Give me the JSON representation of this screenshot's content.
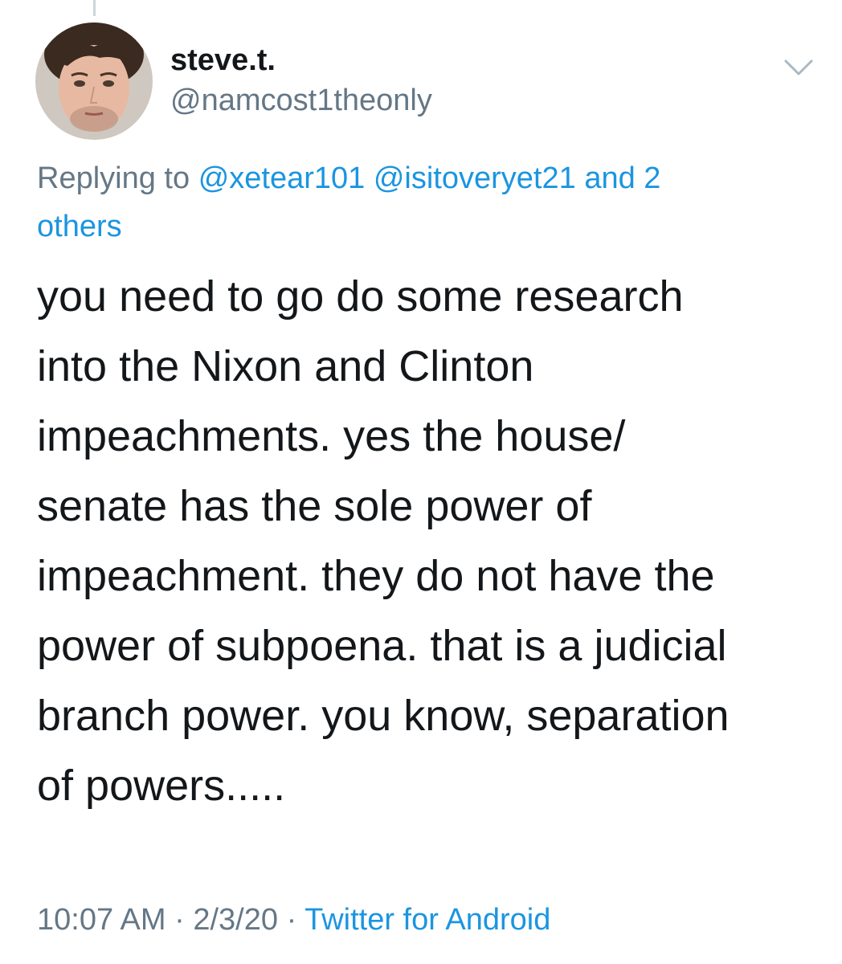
{
  "tweet": {
    "display_name": "steve.t.",
    "handle": "@namcost1theonly",
    "replying_prefix": "Replying to",
    "reply_mentions": [
      "@xetear101",
      "@isitoveryet21"
    ],
    "reply_conjunction": "and 2",
    "reply_others": "others",
    "body_lines": [
      "you need to go do some research",
      "into the Nixon and Clinton",
      "impeachments. yes the house/",
      "senate has the sole power of",
      "impeachment. they do not have the",
      "power of subpoena. that is a judicial",
      "branch power. you know, separation",
      "of powers....."
    ],
    "time": "10:07 AM",
    "separator": "·",
    "date": "2/3/20",
    "source": "Twitter for Android"
  },
  "icons": {
    "avatar": "user-avatar-photo",
    "menu": "chevron-down-icon"
  },
  "colors": {
    "text_primary": "#14171a",
    "text_secondary": "#657786",
    "link": "#1b95e0"
  }
}
